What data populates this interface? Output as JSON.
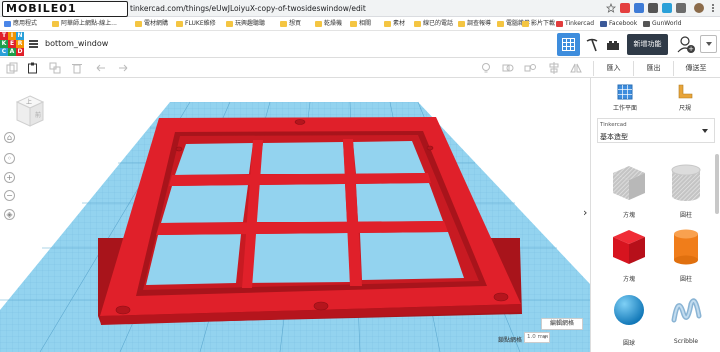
{
  "browser": {
    "logo_text": "MOBILE01",
    "url": "tinkercad.com/things/eUwJLoiyuX-copy-of-twosideswindow/edit",
    "bookmarks": [
      "應用程式",
      "阿華師上網點-線上...",
      "電材網購",
      "FLUKE維修",
      "玩興趣聽聽",
      "想買",
      "乾燥機",
      "相關",
      "素材",
      "線已的電話",
      "調查報導",
      "電腦雜卷",
      "影片下載",
      "Tinkercad",
      "Facebook",
      "GunWorld"
    ]
  },
  "header": {
    "design_title": "bottom_window",
    "new_feature_label": "新增功能",
    "logo_letters": [
      "T",
      "I",
      "N",
      "K",
      "E",
      "R",
      "C",
      "A",
      "D"
    ]
  },
  "toolbar": {
    "import_label": "匯入",
    "export_label": "匯出",
    "send_to_label": "傳送至"
  },
  "viewport": {
    "view_cube_label": "上",
    "view_cube_side": "前",
    "edit_grid_label": "編輯網格",
    "snap_grid_label": "鎖點網格",
    "snap_grid_value": "1.0 mm"
  },
  "panel": {
    "workplane_label": "工作平面",
    "ruler_label": "尺規",
    "library_provider": "Tinkercad",
    "library_name": "基本造型",
    "shapes": [
      {
        "label": "方塊",
        "icon": "box-hole-icon"
      },
      {
        "label": "圓柱",
        "icon": "cylinder-hole-icon"
      },
      {
        "label": "方塊",
        "icon": "box-icon"
      },
      {
        "label": "圓柱",
        "icon": "cylinder-icon"
      },
      {
        "label": "圓球",
        "icon": "sphere-icon"
      },
      {
        "label": "Scribble",
        "icon": "scribble-icon"
      }
    ]
  },
  "colors": {
    "model_red": "#e0202a",
    "grid_blue": "#8fd0ee",
    "accent_blue": "#3e8ddd",
    "header_dark": "#2f3a47"
  }
}
